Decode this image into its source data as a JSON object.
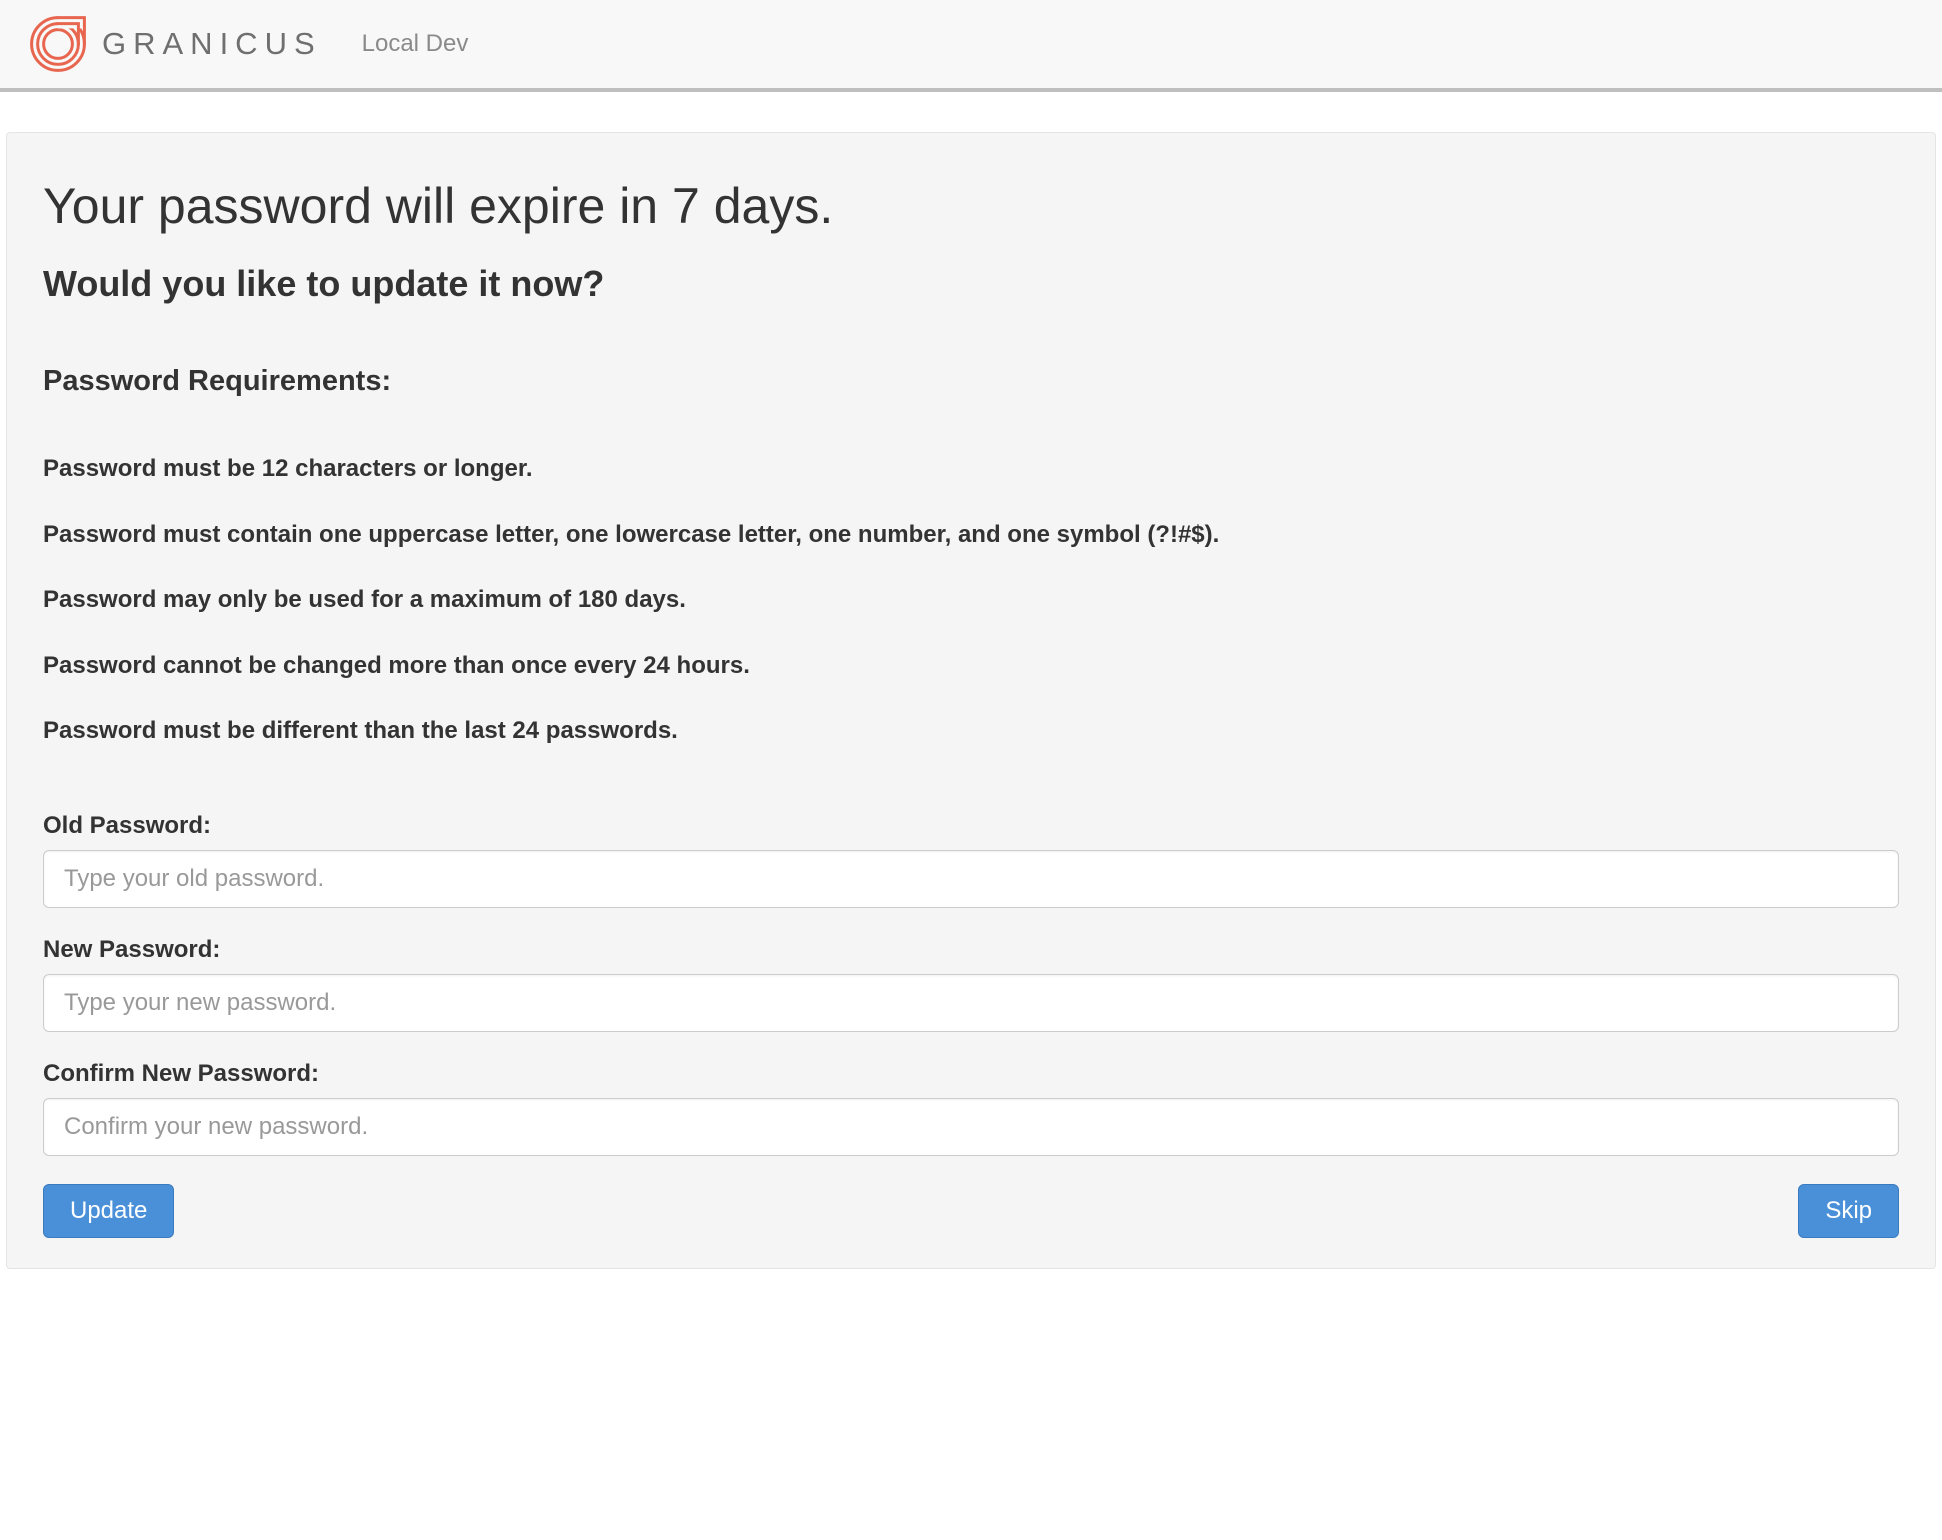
{
  "header": {
    "brand_text": "GRANICUS",
    "env_label": "Local Dev"
  },
  "panel": {
    "title": "Your password will expire in 7 days.",
    "subtitle": "Would you like to update it now?",
    "requirements_heading": "Password Requirements:",
    "requirements": [
      "Password must be 12 characters or longer.",
      "Password must contain one uppercase letter, one lowercase letter, one number, and one symbol (?!#$).",
      "Password may only be used for a maximum of 180 days.",
      "Password cannot be changed more than once every 24 hours.",
      "Password must be different than the last 24 passwords."
    ],
    "form": {
      "old_password": {
        "label": "Old Password:",
        "placeholder": "Type your old password.",
        "value": ""
      },
      "new_password": {
        "label": "New Password:",
        "placeholder": "Type your new password.",
        "value": ""
      },
      "confirm_password": {
        "label": "Confirm New Password:",
        "placeholder": "Confirm your new password.",
        "value": ""
      }
    },
    "actions": {
      "update_label": "Update",
      "skip_label": "Skip"
    }
  },
  "colors": {
    "brand_accent": "#e8664f",
    "button_primary": "#4a90d9"
  }
}
